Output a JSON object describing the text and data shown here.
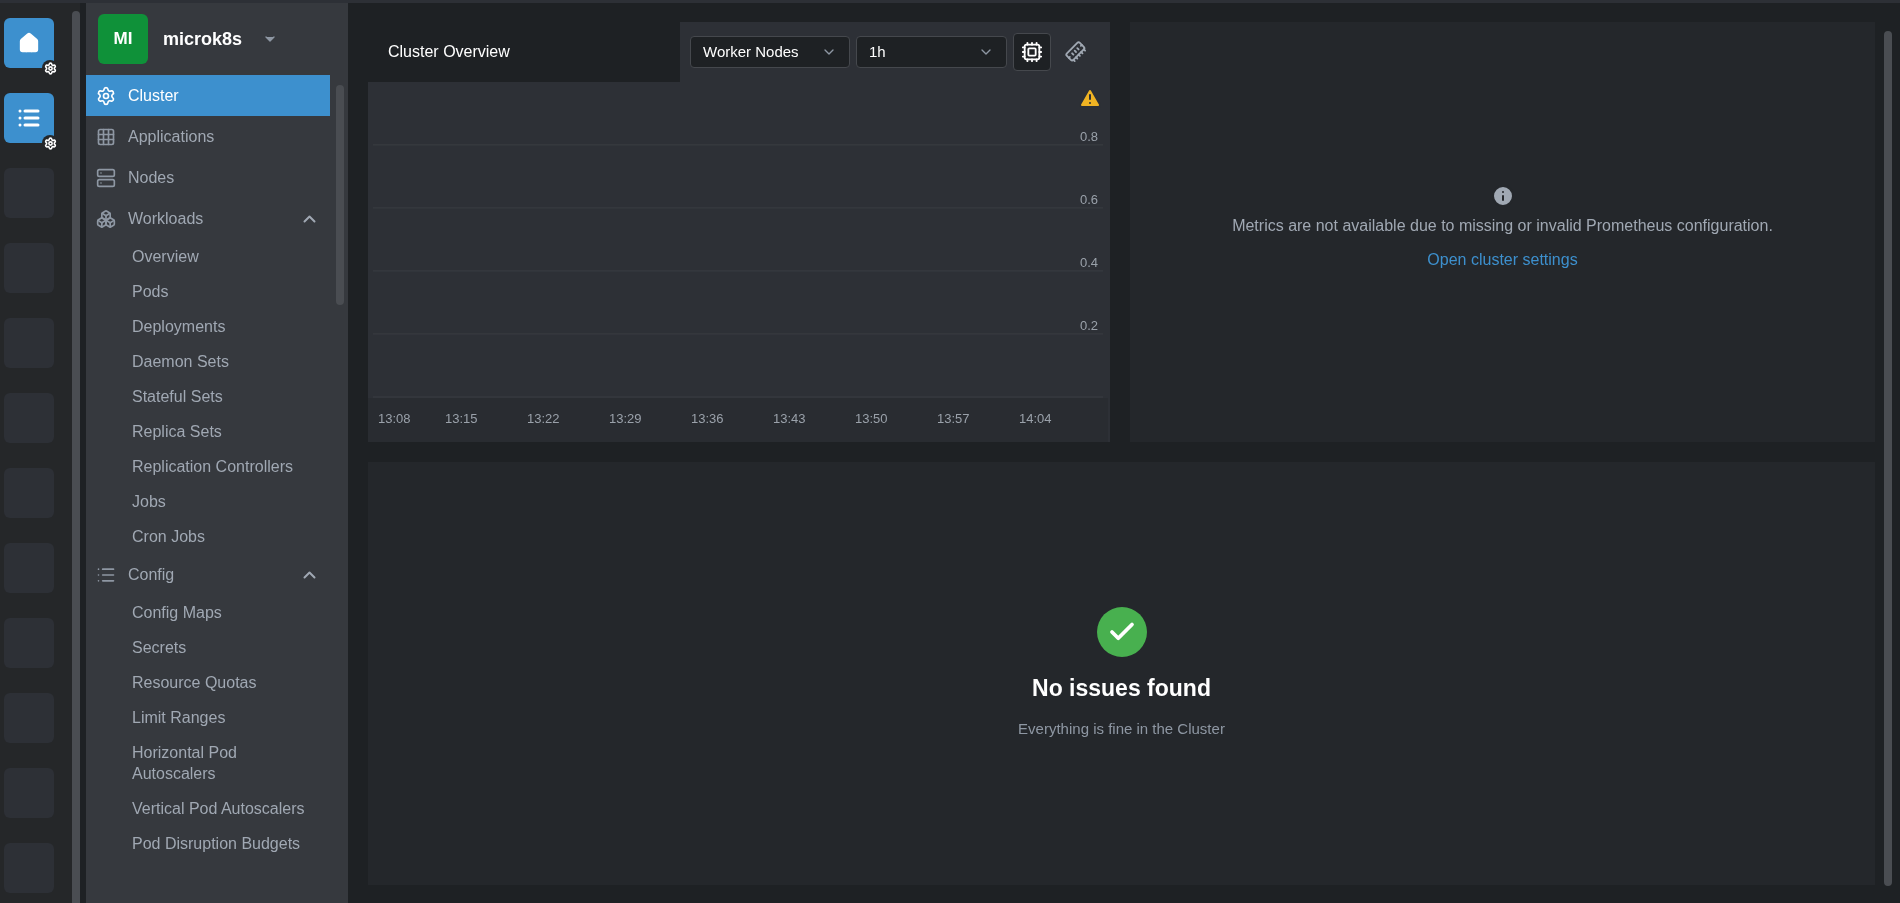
{
  "hotbar": [
    {
      "kind": "home"
    },
    {
      "kind": "catalog"
    },
    {
      "kind": "empty"
    },
    {
      "kind": "empty"
    },
    {
      "kind": "empty"
    },
    {
      "kind": "empty"
    },
    {
      "kind": "empty"
    },
    {
      "kind": "empty"
    },
    {
      "kind": "empty"
    },
    {
      "kind": "empty"
    },
    {
      "kind": "empty"
    },
    {
      "kind": "empty"
    }
  ],
  "cluster": {
    "avatar": "MI",
    "name": "microk8s"
  },
  "sidebar": {
    "items": [
      {
        "kind": "cluster",
        "label": "Cluster",
        "selected": true
      },
      {
        "kind": "apps",
        "label": "Applications",
        "selected": false
      },
      {
        "kind": "nodes",
        "label": "Nodes",
        "selected": false
      },
      {
        "kind": "workloads",
        "label": "Workloads",
        "selected": false,
        "expanded": true,
        "children": [
          {
            "label": "Overview",
            "selected": false
          },
          {
            "label": "Pods",
            "selected": false
          },
          {
            "label": "Deployments",
            "selected": false
          },
          {
            "label": "Daemon Sets",
            "selected": false
          },
          {
            "label": "Stateful Sets",
            "selected": false
          },
          {
            "label": "Replica Sets",
            "selected": false
          },
          {
            "label": "Replication Controllers",
            "selected": false
          },
          {
            "label": "Jobs",
            "selected": false
          },
          {
            "label": "Cron Jobs",
            "selected": false
          }
        ]
      },
      {
        "kind": "config",
        "label": "Config",
        "selected": false,
        "expanded": true,
        "children": [
          {
            "label": "Config Maps",
            "selected": false
          },
          {
            "label": "Secrets",
            "selected": false
          },
          {
            "label": "Resource Quotas",
            "selected": false
          },
          {
            "label": "Limit Ranges",
            "selected": false
          },
          {
            "label": "Horizontal Pod Autoscalers",
            "selected": false
          },
          {
            "label": "Vertical Pod Autoscalers",
            "selected": false
          },
          {
            "label": "Pod Disruption Budgets",
            "selected": false
          }
        ]
      }
    ]
  },
  "overview": {
    "title": "Cluster Overview",
    "node_select": "Worker Nodes",
    "range_select": "1h",
    "metric_buttons": [
      {
        "kind": "cpu",
        "selected": true
      },
      {
        "kind": "memory",
        "selected": false
      }
    ],
    "chart_data": {
      "type": "line",
      "categories": [
        "13:08",
        "13:15",
        "13:22",
        "13:29",
        "13:36",
        "13:43",
        "13:50",
        "13:57",
        "14:04"
      ],
      "grid": true,
      "ylim": [
        -0.143,
        1.19
      ],
      "yticks": [
        0.2,
        0.4,
        0.6,
        0.8
      ]
    }
  },
  "metrics_notice": {
    "message": "Metrics are not available due to missing or invalid Prometheus configuration.",
    "link": "Open cluster settings"
  },
  "issues": {
    "title": "No issues found",
    "subtitle": "Everything is fine in the Cluster"
  }
}
